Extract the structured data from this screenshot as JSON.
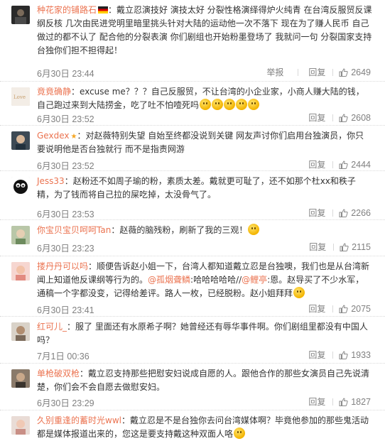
{
  "actions": {
    "report": "举报",
    "reply": "回复"
  },
  "comments": [
    {
      "user": "种花家的铺路石",
      "text": "：戴立忍演技好 演技太好 分裂性格演绎得炉火纯青 在台湾反服贸反课纲反核 几次由民进党明里暗里挑头针对大陆的运动他一次不落下 现在为了赚人民币 自己做过的都不认了 配合他的分裂表演 你们剧组也开始粉墨登场了 我就问一句 分裂国家支持台独你们担不担得起！",
      "time": "6月30日 23:44",
      "likes": "2649"
    },
    {
      "user": "竟竟确静",
      "text": "：excuse me？？？自己反服贸，不让台湾的小企业家，小商人赚大陆的钱，自己跑过来到大陆捞金，吃了吐不怕噎死吗",
      "time": "6月30日 23:52",
      "likes": "2608"
    },
    {
      "user": "Gexdex",
      "text": "：对赵薇特别失望 自始至终都没说到关键 网友声讨你们启用台独演员，你只要说明他是否台独就行 而不是指责网游",
      "time": "6月30日 23:52",
      "likes": "2444"
    },
    {
      "user": "Jess33",
      "text": "：赵粉还不如周子瑜的粉，素质太差。戴就更可耻了，还不如那个杜xx和秩子精，为了钱而将自己拉的屎吃掉，太没骨气了。",
      "time": "6月30日 23:53",
      "likes": "2266"
    },
    {
      "user": "你宝贝宝贝呵呵Tan",
      "text": "：赵薇的脑残粉，刷新了我的三观！",
      "time": "6月30日 23:23",
      "likes": "2115"
    },
    {
      "user": "搂丹丹可以吗",
      "text_a": "：顺便告诉赵小姐一下，台湾人都知道戴立忍是台独噢，我们也是从台湾新闻上知道他反课纲等行为的。",
      "mention1": "@孤烟聋鳞",
      "text_b": ":哈哈哈哈哈//",
      "mention2": "@鲤亭",
      "text_c": ":恩。赵导买了不少水军，通稿一个字都没变，记得给差评。路人一枚，已经脱粉。赵小姐拜拜",
      "time": "6月30日 23:41",
      "likes": "2075"
    },
    {
      "user": "红可儿_",
      "text": "：服了 里面还有水原希子啊？她曾经还有辱华事件啊。你们剧组里都没有中国人吗？",
      "time": "7月1日 00:36",
      "likes": "1933"
    },
    {
      "user": "单枪破双枪",
      "text": "：戴立忍支持那些把慰安妇说成自愿的人。跟他合作的那些女演员自己先说清楚，你们会不会自愿去做慰安妇。",
      "time": "6月30日 23:29",
      "likes": "1827"
    },
    {
      "user": "久别重逢的蓄时光wwl",
      "text": "：戴立忍是不是台独你去问台湾媒体啊？毕竟他参加的那些鬼活动都是媒体报道出来的，您这是要支持戴这种双面人咯",
      "time": "",
      "likes": ""
    }
  ]
}
